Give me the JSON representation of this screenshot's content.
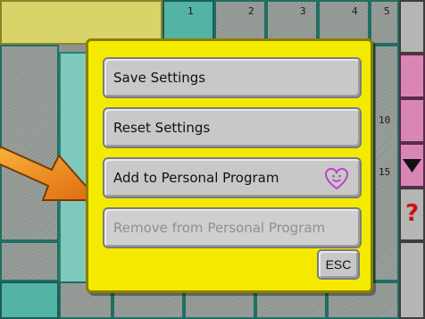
{
  "dialog": {
    "save_label": "Save Settings",
    "reset_label": "Reset Settings",
    "add_label": "Add to Personal Program",
    "remove_label": "Remove from Personal Program",
    "esc_label": "ESC"
  },
  "background": {
    "tab_numbers": [
      "1",
      "2",
      "3",
      "4",
      "5"
    ],
    "side_number": "10",
    "side_number_2": "15"
  },
  "colors": {
    "dialog_bg": "#f4ea00",
    "arrow_orange": "#f28a1a",
    "heart_purple": "#c040c8",
    "teal": "#53b3a5"
  },
  "icons": {
    "favorite": "heart-smiley-icon",
    "pointer": "arrow-pointer-icon"
  }
}
